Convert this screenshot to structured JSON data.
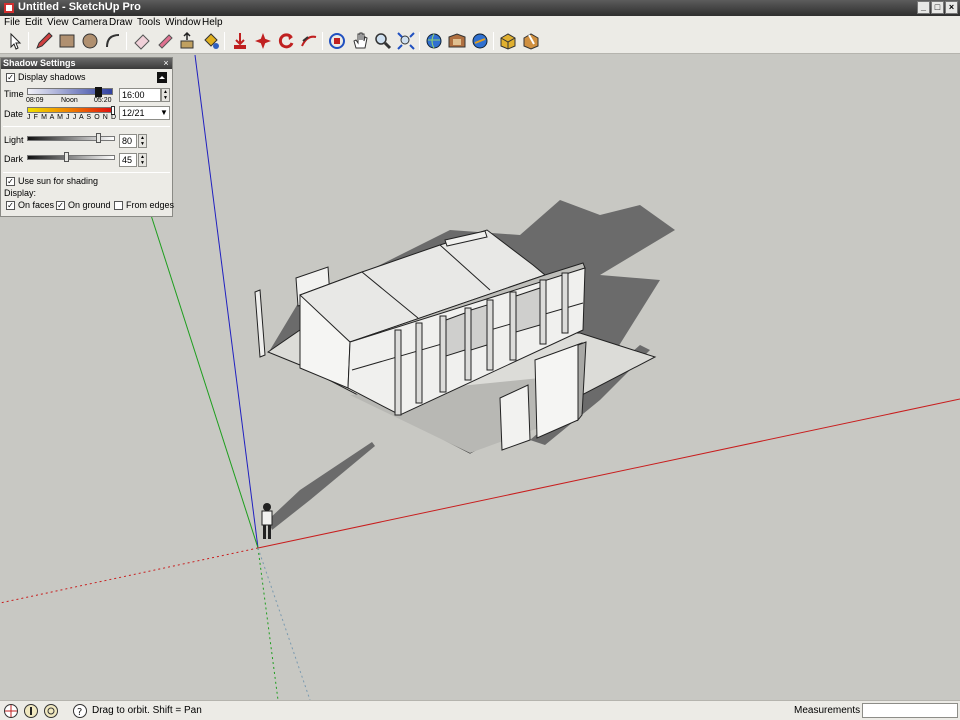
{
  "window": {
    "title": "Untitled - SketchUp Pro"
  },
  "menu": [
    "File",
    "Edit",
    "View",
    "Camera",
    "Draw",
    "Tools",
    "Window",
    "Help"
  ],
  "toolbar": {
    "tools": [
      "select-icon",
      "pencil-icon",
      "rectangle-icon",
      "circle-icon",
      "arc-icon",
      "eraser-icon",
      "paint-bucket-icon",
      "push-pull-icon",
      "move-icon",
      "rotate-icon",
      "follow-me-icon",
      "offset-icon",
      "orbit-icon",
      "pan-icon",
      "zoom-icon",
      "zoom-extents-icon",
      "get-models-icon",
      "share-model-icon",
      "extension-warehouse-icon",
      "components-icon",
      "materials-icon"
    ]
  },
  "shadow_panel": {
    "title": "Shadow Settings",
    "display_shadows": {
      "label": "Display shadows",
      "checked": true
    },
    "time": {
      "label": "Time",
      "sunrise": "08:09",
      "noon": "Noon",
      "sunset": "05:20",
      "value": "16:00",
      "level": 0.78
    },
    "date": {
      "label": "Date",
      "months": "J F M A M J J A S O N D",
      "value": "12/21",
      "level": 0.97
    },
    "light": {
      "label": "Light",
      "value": "80",
      "level": 0.8
    },
    "dark": {
      "label": "Dark",
      "value": "45",
      "level": 0.45
    },
    "use_sun": {
      "label": "Use sun for shading",
      "checked": true
    },
    "display_label": "Display:",
    "on_faces": {
      "label": "On faces",
      "checked": true
    },
    "on_ground": {
      "label": "On ground",
      "checked": true
    },
    "from_edges": {
      "label": "From edges",
      "checked": false
    }
  },
  "status": {
    "message": "Drag to orbit.  Shift = Pan",
    "measurements_label": "Measurements",
    "measurements_value": ""
  },
  "colors": {
    "red_axis": "#c81e1e",
    "green_axis": "#1e9e1e",
    "blue_axis": "#2020c0",
    "background": "#c8c8c3"
  }
}
